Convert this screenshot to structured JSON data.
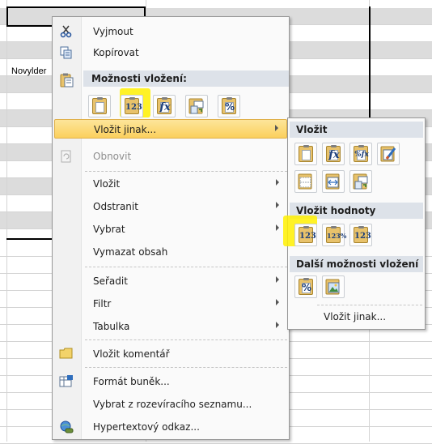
{
  "sheet": {
    "cell_text": "Novylder"
  },
  "menu": {
    "items": [
      {
        "label": "Vyjmout",
        "icon": "scissors-icon"
      },
      {
        "label": "Kopírovat",
        "icon": "copy-icon"
      },
      {
        "header": "Možnosti vložení:",
        "icon": "paste-icon"
      },
      {
        "label": "Vložit jinak...",
        "highlighted": true
      },
      {
        "label": "Obnovit",
        "disabled": true,
        "icon": "refresh-icon"
      },
      {
        "label": "Vložit",
        "submenu": true
      },
      {
        "label": "Odstranit",
        "submenu": true
      },
      {
        "label": "Vybrat",
        "submenu": true
      },
      {
        "label": "Vymazat obsah"
      },
      {
        "label": "Seřadit",
        "submenu": true
      },
      {
        "label": "Filtr",
        "submenu": true
      },
      {
        "label": "Tabulka",
        "submenu": true
      },
      {
        "label": "Vložit komentář",
        "icon": "comment-icon"
      },
      {
        "label": "Formát buněk...",
        "icon": "format-cells-icon"
      },
      {
        "label": "Vybrat z rozevíracího seznamu..."
      },
      {
        "label": "Hypertextový odkaz...",
        "icon": "hyperlink-icon"
      }
    ],
    "paste_options": [
      {
        "name": "paste-icon",
        "glyph": ""
      },
      {
        "name": "paste-values-icon",
        "glyph": "123"
      },
      {
        "name": "paste-formulas-icon",
        "glyph": "fx"
      },
      {
        "name": "paste-transpose-icon",
        "glyph": ""
      },
      {
        "name": "paste-formatting-icon",
        "glyph": "%"
      }
    ]
  },
  "submenu": {
    "header_paste": "Vložit",
    "header_values": "Vložit hodnoty",
    "header_other": "Další možnosti vložení",
    "footer": "Vložit jinak...",
    "paste_buttons_row1": [
      {
        "name": "paste-icon",
        "glyph": ""
      },
      {
        "name": "paste-formulas-icon",
        "glyph": "fx"
      },
      {
        "name": "paste-formulas-number-format-icon",
        "glyph": "%fx"
      },
      {
        "name": "paste-keep-source-formatting-icon",
        "glyph": ""
      }
    ],
    "paste_buttons_row2": [
      {
        "name": "paste-no-borders-icon",
        "glyph": ""
      },
      {
        "name": "paste-keep-column-widths-icon",
        "glyph": ""
      },
      {
        "name": "paste-transpose-icon",
        "glyph": ""
      }
    ],
    "value_buttons": [
      {
        "name": "paste-values-icon",
        "glyph": "123"
      },
      {
        "name": "paste-values-number-format-icon",
        "glyph": "123%"
      },
      {
        "name": "paste-values-source-formatting-icon",
        "glyph": "123"
      }
    ],
    "other_buttons": [
      {
        "name": "paste-formatting-icon",
        "glyph": "%"
      },
      {
        "name": "paste-picture-icon",
        "glyph": ""
      }
    ]
  },
  "colors": {
    "highlight_yellow": "#fff000",
    "menu_hover": "#fbd05d",
    "section_header": "#dde2e9"
  }
}
